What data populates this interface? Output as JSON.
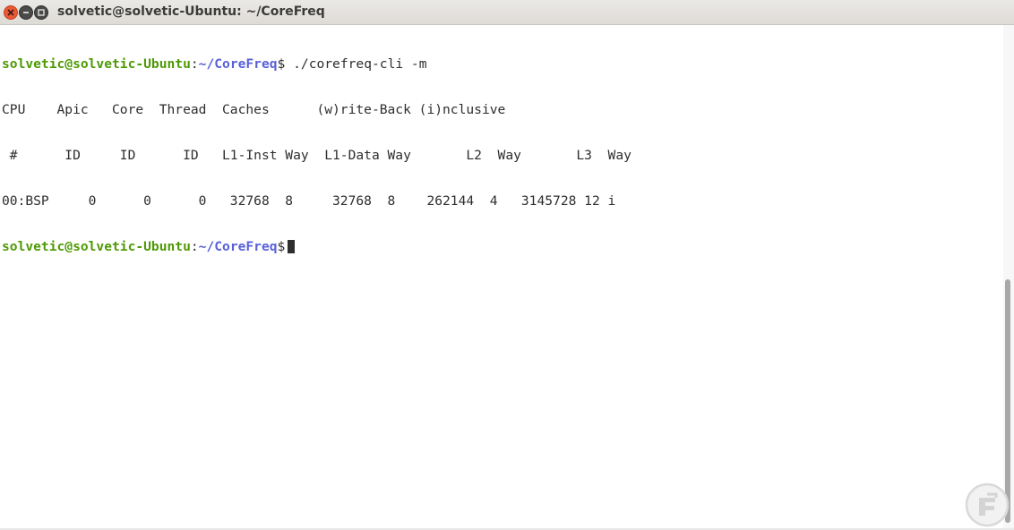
{
  "window": {
    "title": "solvetic@solvetic-Ubuntu: ~/CoreFreq",
    "controls": [
      "close-icon",
      "minimize-icon",
      "maximize-icon"
    ]
  },
  "prompt": {
    "user_host": "solvetic@solvetic-Ubuntu",
    "separator": ":",
    "path": "~/CoreFreq",
    "symbol": "$"
  },
  "terminal": {
    "command": " ./corefreq-cli -m",
    "output_lines": [
      "CPU    Apic   Core  Thread  Caches      (w)rite-Back (i)nclusive",
      " #      ID     ID      ID   L1-Inst Way  L1-Data Way       L2  Way       L3  Way",
      "00:BSP     0      0      0   32768  8     32768  8    262144  4   3145728 12 i"
    ],
    "current_input": " "
  },
  "colors": {
    "prompt_user": "#4e9a06",
    "prompt_path": "#5860d8",
    "text": "#2e2e2e",
    "close_button": "#ea5834"
  }
}
